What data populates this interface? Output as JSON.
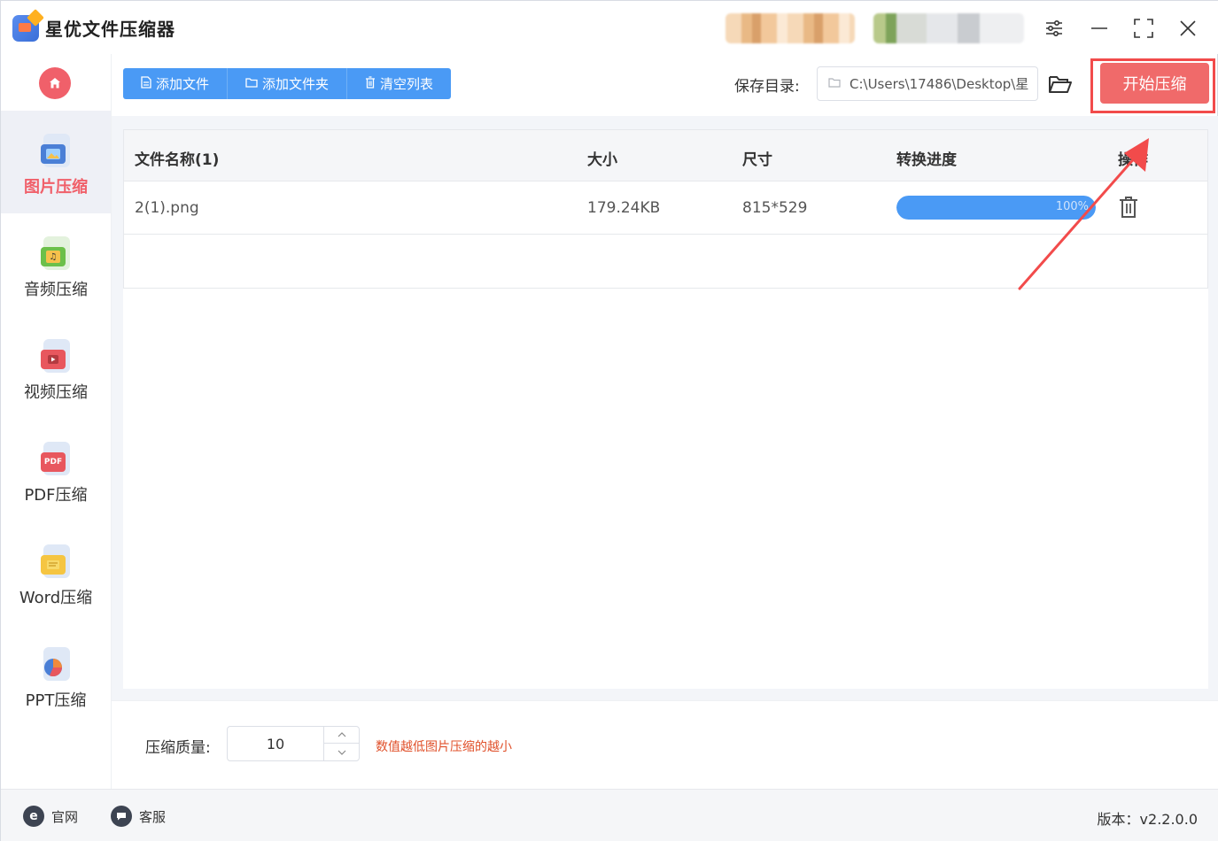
{
  "app": {
    "title": "星优文件压缩器"
  },
  "sidebar": {
    "items": [
      {
        "label": "图片压缩",
        "icon": "image-icon",
        "color": "#4a7fd6",
        "active": true
      },
      {
        "label": "音频压缩",
        "icon": "music-icon",
        "color": "#6cc04a",
        "active": false
      },
      {
        "label": "视频压缩",
        "icon": "video-icon",
        "color": "#e8575e",
        "active": false
      },
      {
        "label": "PDF压缩",
        "icon": "pdf-icon",
        "color": "#e8575e",
        "badge": "PDF",
        "active": false
      },
      {
        "label": "Word压缩",
        "icon": "word-icon",
        "color": "#f5c542",
        "active": false
      },
      {
        "label": "PPT压缩",
        "icon": "ppt-icon",
        "color": "#f08a3c",
        "active": false
      }
    ]
  },
  "toolbar": {
    "add_file": "添加文件",
    "add_folder": "添加文件夹",
    "clear_list": "清空列表",
    "save_dir_label": "保存目录:",
    "save_path": "C:\\Users\\17486\\Desktop\\星",
    "start_button": "开始压缩"
  },
  "table": {
    "headers": [
      "文件名称(1)",
      "大小",
      "尺寸",
      "转换进度",
      "操作"
    ],
    "rows": [
      {
        "name": "2(1).png",
        "size": "179.24KB",
        "dimensions": "815*529",
        "progress": 100,
        "progress_text": "100%"
      }
    ]
  },
  "settings": {
    "quality_label": "压缩质量:",
    "quality_value": "10",
    "quality_hint": "数值越低图片压缩的越小"
  },
  "footer": {
    "website": "官网",
    "support": "客服",
    "version": "版本：v2.2.0.0"
  },
  "colors": {
    "accent_blue": "#4a9af5",
    "accent_red": "#f06a6a",
    "annotation_red": "#f24b4b"
  }
}
